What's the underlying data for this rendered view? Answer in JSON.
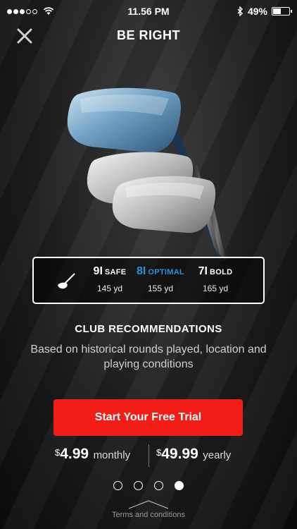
{
  "status_bar": {
    "time": "11.56 PM",
    "battery_text": "49%",
    "icons": [
      "signal-dots-icon",
      "wifi-icon",
      "bluetooth-icon",
      "battery-icon"
    ]
  },
  "header": {
    "title": "BE RIGHT",
    "close_icon": "close-icon"
  },
  "hero": {
    "icon": "golf-irons-image"
  },
  "recommendations": {
    "icon": "golf-club-icon",
    "options": [
      {
        "club": "9I",
        "tag": "SAFE",
        "distance": "145 yd"
      },
      {
        "club": "8I",
        "tag": "OPTIMAL",
        "distance": "155 yd"
      },
      {
        "club": "7I",
        "tag": "BOLD",
        "distance": "165 yd"
      }
    ],
    "optimal_color": "#2b8fd6"
  },
  "feature": {
    "heading": "CLUB RECOMMENDATIONS",
    "description": "Based on historical rounds played, location and playing conditions"
  },
  "cta": {
    "label": "Start Your Free Trial",
    "color": "#f21d16"
  },
  "pricing": {
    "monthly": {
      "currency": "$",
      "amount": "4.99",
      "period": "monthly"
    },
    "yearly": {
      "currency": "$",
      "amount": "49.99",
      "period": "yearly"
    }
  },
  "pager": {
    "count": 4,
    "active_index": 3
  },
  "footer": {
    "terms_label": "Terms and conditions",
    "terms_icon": "chevron-up-icon"
  }
}
